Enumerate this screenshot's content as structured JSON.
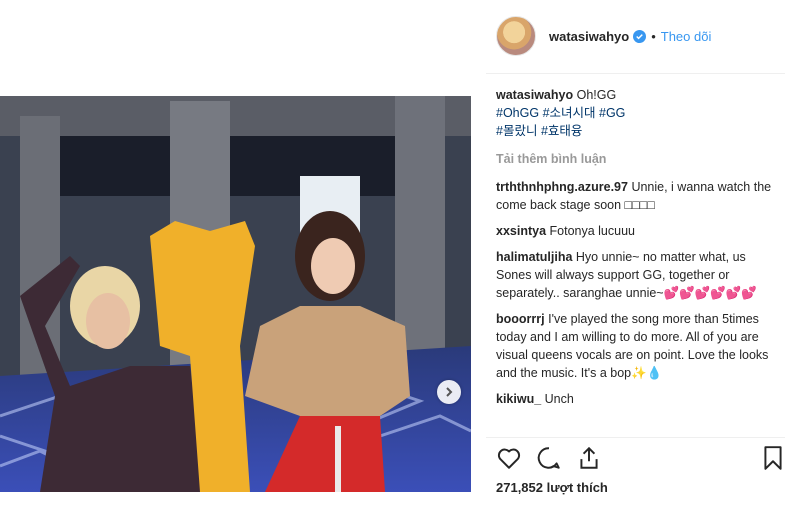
{
  "header": {
    "username": "watasiwahyo",
    "verified_icon": "verified-badge-icon",
    "separator": "•",
    "follow_label": "Theo dõi"
  },
  "caption": {
    "username": "watasiwahyo",
    "text": "Oh!GG",
    "tags_line1": [
      "#OhGG",
      "#소녀시대",
      "#GG"
    ],
    "tags_line2": [
      "#몰랐니",
      "#효태융"
    ]
  },
  "load_more_label": "Tải thêm bình luận",
  "comments": [
    {
      "username": "trththnhphng.azure.97",
      "text": "Unnie, i wanna watch the come back stage soon □□□□"
    },
    {
      "username": "xxsintya",
      "text": "Fotonya lucuuu"
    },
    {
      "username": "halimatuljiha",
      "text": "Hyo unnie~ no matter what, us Sones will always support GG, together or separately.. saranghae unnie~💕💕💕💕💕💕"
    },
    {
      "username": "booorrrj",
      "text": "I've played the song more than 5times today and I am willing to do more. All of you are visual queens vocals are on point. Love the looks and the music. It's a bop✨💧"
    },
    {
      "username": "kikiwu_",
      "text": "Unch"
    }
  ],
  "likes_label": "271,852 lượt thích",
  "colors": {
    "accent": "#3897f0",
    "hashtag": "#003569",
    "muted": "#999999"
  },
  "icons": {
    "like": "heart-outline-icon",
    "comment": "comment-bubble-icon",
    "share": "share-upload-icon",
    "save": "bookmark-icon",
    "next": "chevron-right-icon"
  }
}
